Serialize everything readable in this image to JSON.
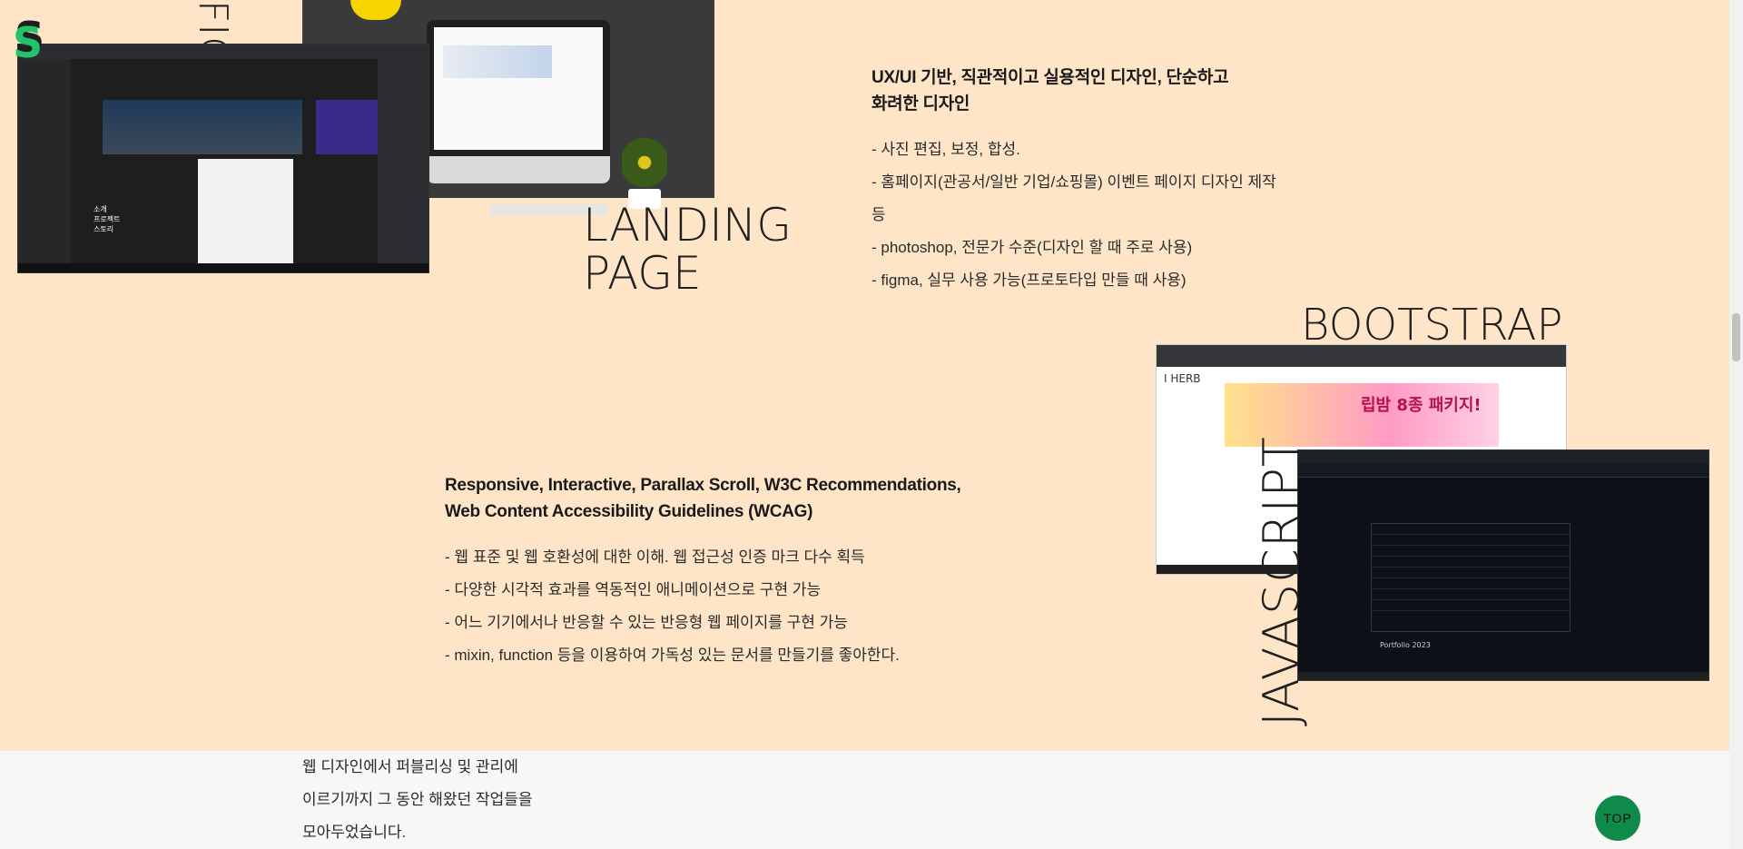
{
  "labels": {
    "figma": "FIGMA",
    "landing_line1": "LANDING",
    "landing_line2": "PAGE",
    "bootstrap": "BOOTSTRAP",
    "javascript": "JAVASCRIPT"
  },
  "ux_block": {
    "title_line1": "UX/UI 기반, 직관적이고 실용적인 디자인, 단순하고",
    "title_line2": "화려한 디자인",
    "items": [
      "-  사진 편집, 보정, 합성.",
      "-  홈페이지(관공서/일반 기업/쇼핑몰) 이벤트 페이지 디자인 제작",
      "등",
      "-  photoshop, 전문가 수준(디자인 할 때 주로 사용)",
      "-  figma, 실무 사용 가능(프로토타입 만들 때 사용)"
    ]
  },
  "resp_block": {
    "title_line1": "Responsive, Interactive, Parallax Scroll, W3C Recommendations,",
    "title_line2": "Web Content Accessibility Guidelines (WCAG)",
    "items": [
      "-  웹 표준 및 웹 호환성에 대한 이해. 웹 접근성 인증 마크 다수 획득",
      "-  다양한 시각적 효과를 역동적인 애니메이션으로 구현 가능",
      "-  어느 기기에서나 반응할 수 있는 반응형 웹 페이지를 구현 가능",
      "-  mixin, function 등을 이용하여 가독성 있는 문서를 만들기를 좋아한다."
    ]
  },
  "description": {
    "line1": "웹 디자인에서 퍼블리싱 및 관리에",
    "line2": "이르기까지 그 동안 해왔던 작업들을",
    "line3": "모아두었습니다."
  },
  "screens": {
    "figma_text_line1": "소개",
    "figma_text_line2": "프로젝트",
    "figma_text_line3": "스토리",
    "iherb_brand": "I HERB",
    "iherb_hero": "립밤 8종 패키지!",
    "github_readme": "Portfolio 2023"
  },
  "top_button": "TOP",
  "colors": {
    "background": "#ffe5c8",
    "accent": "#0f8a4a",
    "logo_green": "#21c36b"
  }
}
